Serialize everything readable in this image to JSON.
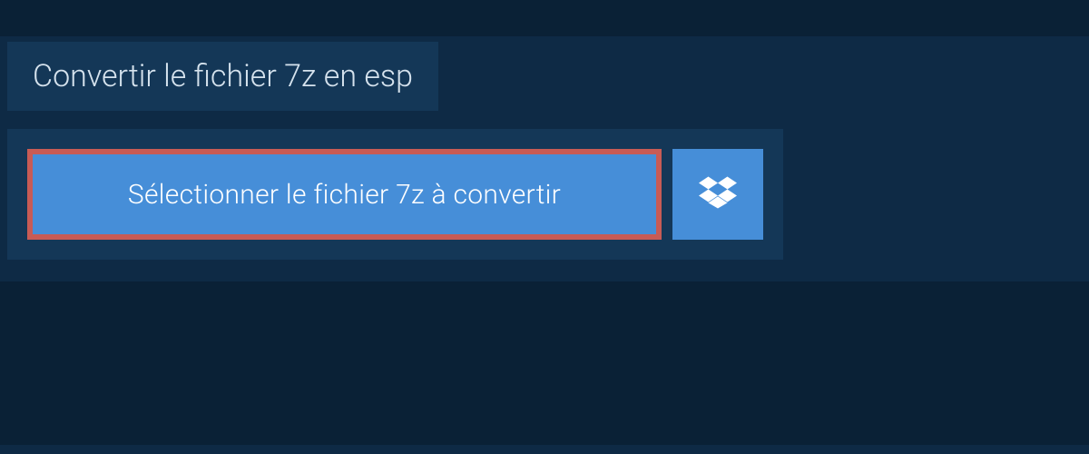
{
  "header": {
    "title": "Convertir le fichier 7z en esp"
  },
  "actions": {
    "select_file_label": "Sélectionner le fichier 7z à convertir"
  }
}
